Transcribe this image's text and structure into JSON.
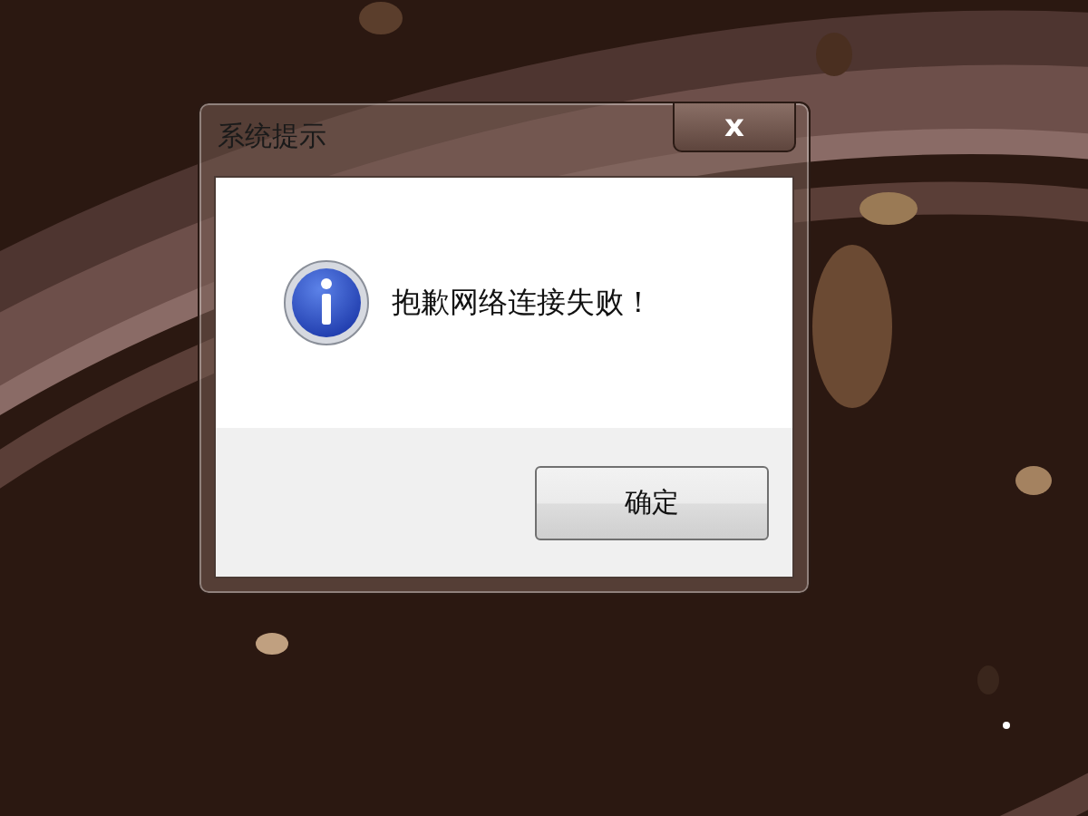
{
  "dialog": {
    "title": "系统提示",
    "close_label": "x",
    "message": "抱歉网络连接失败！",
    "buttons": [
      "确定"
    ]
  }
}
